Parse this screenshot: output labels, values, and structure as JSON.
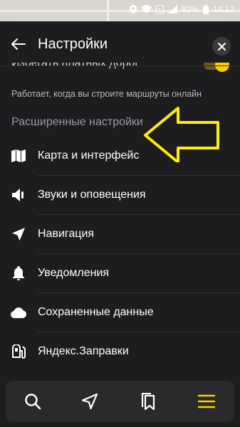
{
  "status_bar": {
    "battery": "92%",
    "time": "14:12"
  },
  "header": {
    "title": "Настройки",
    "back_icon": "arrow-left-icon",
    "close_icon": "close-icon"
  },
  "partial_setting": {
    "label": "Избегать платных дорог",
    "enabled": true
  },
  "hint": "Работает, когда вы строите маршруты онлайн",
  "section_title": "Расширенные настройки",
  "menu": [
    {
      "label": "Карта и интерфейс",
      "icon": "map-icon"
    },
    {
      "label": "Звуки и оповещения",
      "icon": "speaker-icon"
    },
    {
      "label": "Навигация",
      "icon": "navigation-arrow-icon"
    },
    {
      "label": "Уведомления",
      "icon": "bell-icon"
    },
    {
      "label": "Сохраненные данные",
      "icon": "cloud-icon"
    },
    {
      "label": "Яндекс.Заправки",
      "icon": "fuel-pump-icon"
    }
  ],
  "bottom_nav": [
    {
      "name": "search",
      "icon": "search-icon"
    },
    {
      "name": "route",
      "icon": "navigation-arrow-icon"
    },
    {
      "name": "bookmarks",
      "icon": "bookmark-icon"
    },
    {
      "name": "menu",
      "icon": "menu-icon"
    }
  ],
  "colors": {
    "background": "#1d1d1f",
    "accent": "#ffcc00",
    "annotation_arrow": "#ffee00"
  }
}
